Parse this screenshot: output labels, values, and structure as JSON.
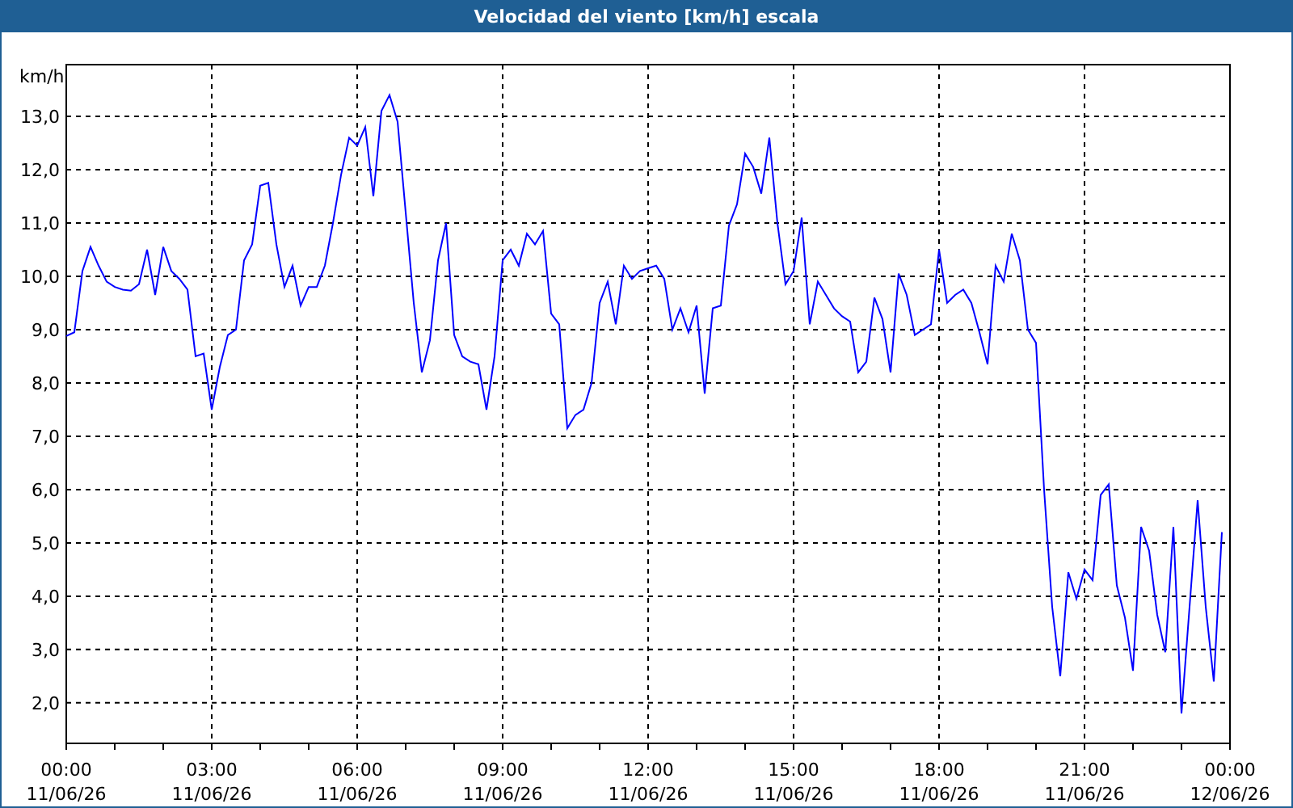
{
  "window": {
    "title": "Velocidad del viento [km/h] escala"
  },
  "chart": {
    "chart_data": {
      "type": "line",
      "grid": true,
      "ylabel": "km/h",
      "ylim": [
        1.24,
        13.97
      ],
      "yticks": [
        {
          "value": 2,
          "label": "2,0"
        },
        {
          "value": 3,
          "label": "3,0"
        },
        {
          "value": 4,
          "label": "4,0"
        },
        {
          "value": 5,
          "label": "5,0"
        },
        {
          "value": 6,
          "label": "6,0"
        },
        {
          "value": 7,
          "label": "7,0"
        },
        {
          "value": 8,
          "label": "8,0"
        },
        {
          "value": 9,
          "label": "9,0"
        },
        {
          "value": 10,
          "label": "10,0"
        },
        {
          "value": 11,
          "label": "11,0"
        },
        {
          "value": 12,
          "label": "12,0"
        },
        {
          "value": 13,
          "label": "13,0"
        }
      ],
      "categories": [
        "00:00 11/06/26",
        null,
        null,
        null,
        null,
        null,
        null,
        null,
        null,
        null,
        null,
        null,
        null,
        null,
        null,
        null,
        null,
        null,
        "03:00 11/06/26",
        null,
        null,
        null,
        null,
        null,
        null,
        null,
        null,
        null,
        null,
        null,
        null,
        null,
        null,
        null,
        null,
        null,
        "06:00 11/06/26",
        null,
        null,
        null,
        null,
        null,
        null,
        null,
        null,
        null,
        null,
        null,
        null,
        null,
        null,
        null,
        null,
        null,
        "09:00 11/06/26",
        null,
        null,
        null,
        null,
        null,
        null,
        null,
        null,
        null,
        null,
        null,
        null,
        null,
        null,
        null,
        null,
        null,
        "12:00 11/06/26",
        null,
        null,
        null,
        null,
        null,
        null,
        null,
        null,
        null,
        null,
        null,
        null,
        null,
        null,
        null,
        null,
        null,
        "15:00 11/06/26",
        null,
        null,
        null,
        null,
        null,
        null,
        null,
        null,
        null,
        null,
        null,
        null,
        null,
        null,
        null,
        null,
        null,
        "18:00 11/06/26",
        null,
        null,
        null,
        null,
        null,
        null,
        null,
        null,
        null,
        null,
        null,
        null,
        null,
        null,
        null,
        null,
        null,
        "21:00 11/06/26",
        null,
        null,
        null,
        null,
        null,
        null,
        null,
        null,
        null,
        null,
        null,
        null,
        null,
        null,
        null,
        null,
        null,
        "00:00 12/06/26"
      ],
      "series": [
        {
          "color": "#0000ff",
          "values": [
            8.88,
            8.95,
            10.1,
            10.55,
            10.2,
            9.9,
            9.8,
            9.75,
            9.73,
            9.85,
            10.5,
            9.65,
            10.55,
            10.1,
            9.95,
            9.75,
            8.5,
            8.55,
            7.5,
            8.3,
            8.9,
            9.0,
            10.3,
            10.6,
            11.7,
            11.75,
            10.6,
            9.8,
            10.2,
            9.45,
            9.8,
            9.8,
            10.2,
            11.0,
            11.9,
            12.6,
            12.45,
            12.8,
            11.5,
            13.1,
            13.4,
            12.9,
            11.2,
            9.5,
            8.2,
            8.8,
            10.3,
            11.0,
            8.9,
            8.5,
            8.4,
            8.35,
            7.5,
            8.5,
            10.3,
            10.5,
            10.2,
            10.8,
            10.6,
            10.85,
            9.3,
            9.1,
            7.15,
            7.4,
            7.5,
            8.0,
            9.5,
            9.9,
            9.1,
            10.2,
            9.95,
            10.1,
            10.15,
            10.2,
            9.95,
            9.0,
            9.4,
            8.95,
            9.45,
            7.8,
            9.4,
            9.45,
            10.95,
            11.35,
            12.3,
            12.05,
            11.55,
            12.6,
            11.0,
            9.85,
            10.1,
            11.1,
            9.1,
            9.9,
            9.65,
            9.4,
            9.25,
            9.15,
            8.2,
            8.4,
            9.6,
            9.2,
            8.2,
            10.05,
            9.65,
            8.9,
            9.0,
            9.1,
            10.5,
            9.5,
            9.65,
            9.75,
            9.5,
            8.95,
            8.35,
            10.2,
            9.9,
            10.8,
            10.3,
            9.0,
            8.75,
            6.0,
            3.8,
            2.5,
            4.45,
            3.95,
            4.5,
            4.3,
            5.9,
            6.1,
            4.2,
            3.6,
            2.6,
            5.3,
            4.85,
            3.65,
            2.95,
            5.3,
            1.8,
            3.8,
            5.8,
            3.8,
            2.4,
            5.2,
            null
          ]
        }
      ]
    }
  }
}
